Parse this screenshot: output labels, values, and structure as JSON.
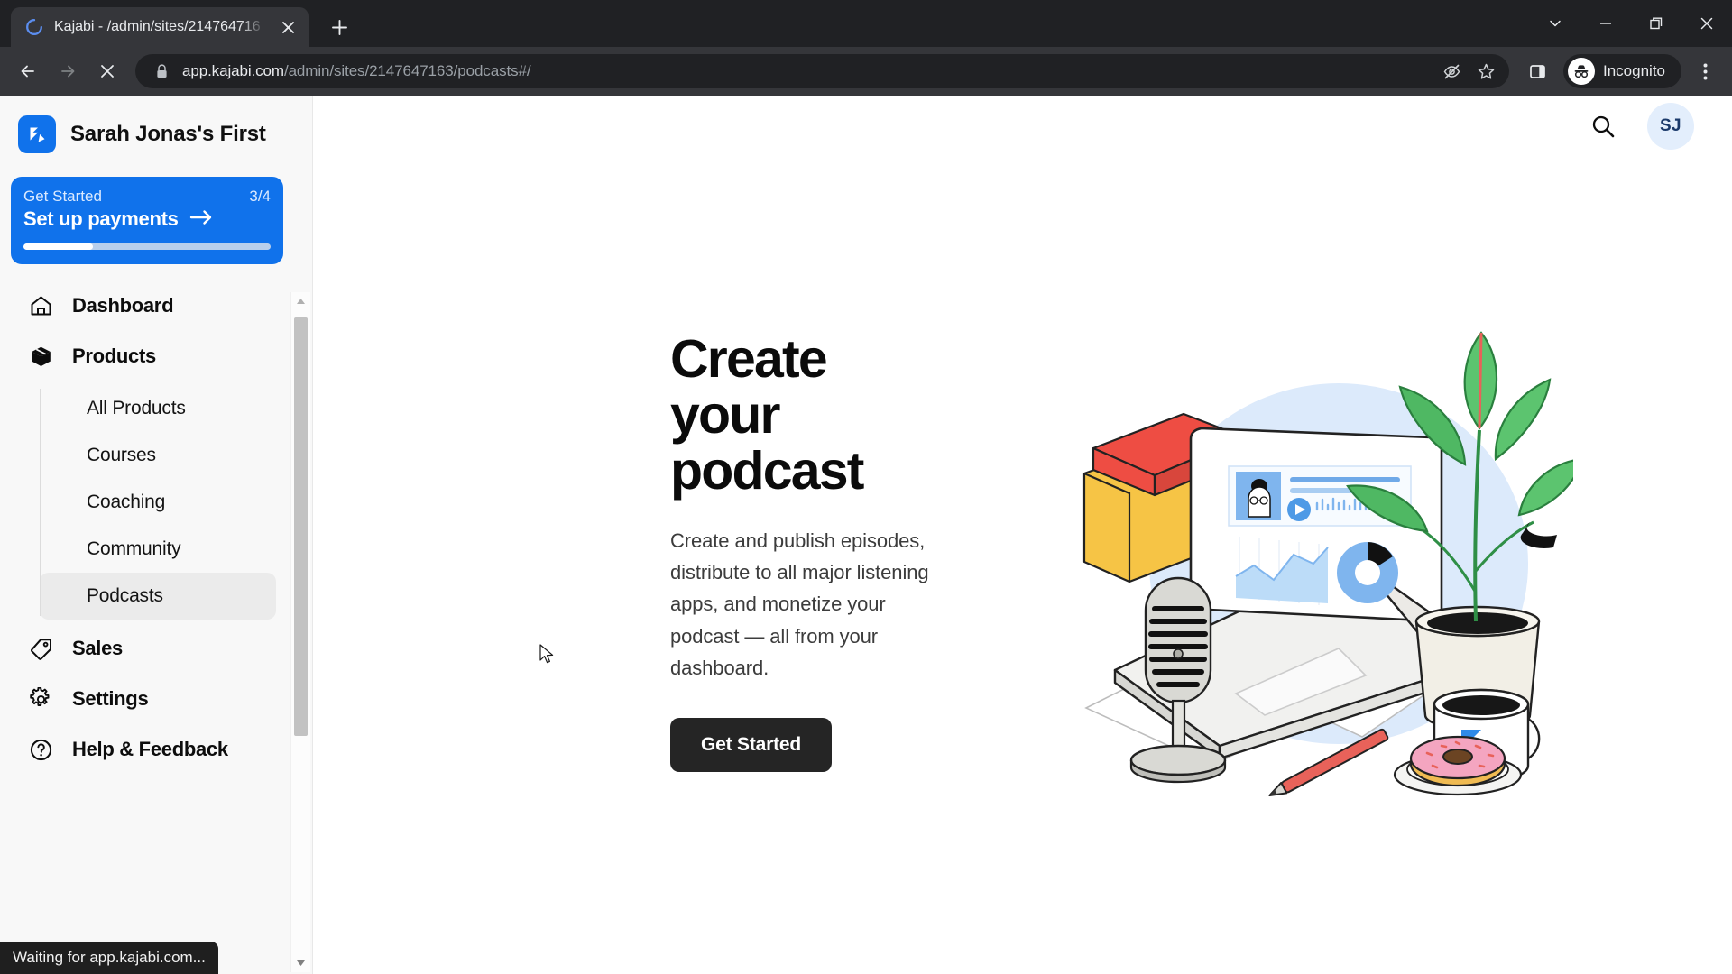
{
  "browser": {
    "tab": {
      "title": "Kajabi - /admin/sites/214764716",
      "spinner_color": "#5b8dee",
      "close_icon": "close-icon"
    },
    "new_tab_icon": "plus-icon",
    "window_controls": [
      {
        "name": "tab-search",
        "icon": "chevron-down-icon"
      },
      {
        "name": "minimize",
        "icon": "minimize-icon"
      },
      {
        "name": "maximize",
        "icon": "restore-icon"
      },
      {
        "name": "close",
        "icon": "close-icon"
      }
    ],
    "nav": {
      "back_icon": "arrow-left-icon",
      "forward_icon": "arrow-right-icon",
      "stop_icon": "stop-loading-icon"
    },
    "omnibox": {
      "lock_icon": "lock-icon",
      "url_host": "app.kajabi.com",
      "url_path": "/admin/sites/2147647163/podcasts#/",
      "tracking_icon": "eye-off-icon",
      "bookmark_icon": "star-icon",
      "side_panel_icon": "side-panel-icon"
    },
    "incognito": {
      "label": "Incognito",
      "icon": "incognito-icon"
    },
    "menu_icon": "kebab-menu-icon",
    "status_text": "Waiting for app.kajabi.com..."
  },
  "sidebar": {
    "brand": {
      "name": "Sarah Jonas's First",
      "logo_icon": "kajabi-logo-icon",
      "logo_color": "#1072EB"
    },
    "get_started": {
      "label": "Get Started",
      "count": "3/4",
      "action": "Set up payments",
      "arrow_icon": "arrow-right-icon",
      "progress_percent": 28,
      "accent": "#1072EB"
    },
    "nav": [
      {
        "label": "Dashboard",
        "icon": "home-icon"
      },
      {
        "label": "Products",
        "icon": "box-icon"
      },
      {
        "label": "Sales",
        "icon": "tag-icon"
      },
      {
        "label": "Settings",
        "icon": "gear-icon"
      },
      {
        "label": "Help & Feedback",
        "icon": "question-circle-icon"
      }
    ],
    "products_subnav": [
      {
        "label": "All Products",
        "active": false
      },
      {
        "label": "Courses",
        "active": false
      },
      {
        "label": "Coaching",
        "active": false
      },
      {
        "label": "Community",
        "active": false
      },
      {
        "label": "Podcasts",
        "active": true
      }
    ],
    "scrollbar": {
      "up_icon": "scroll-up-arrow-icon",
      "down_icon": "scroll-down-arrow-icon"
    }
  },
  "header": {
    "search_icon": "search-icon",
    "avatar_initials": "SJ"
  },
  "hero": {
    "title": "Create your podcast",
    "subtitle": "Create and publish episodes, distribute to all major listening apps, and monetize your podcast — all from your dashboard.",
    "button_label": "Get Started",
    "illustration_name": "podcast-desk-illustration"
  }
}
